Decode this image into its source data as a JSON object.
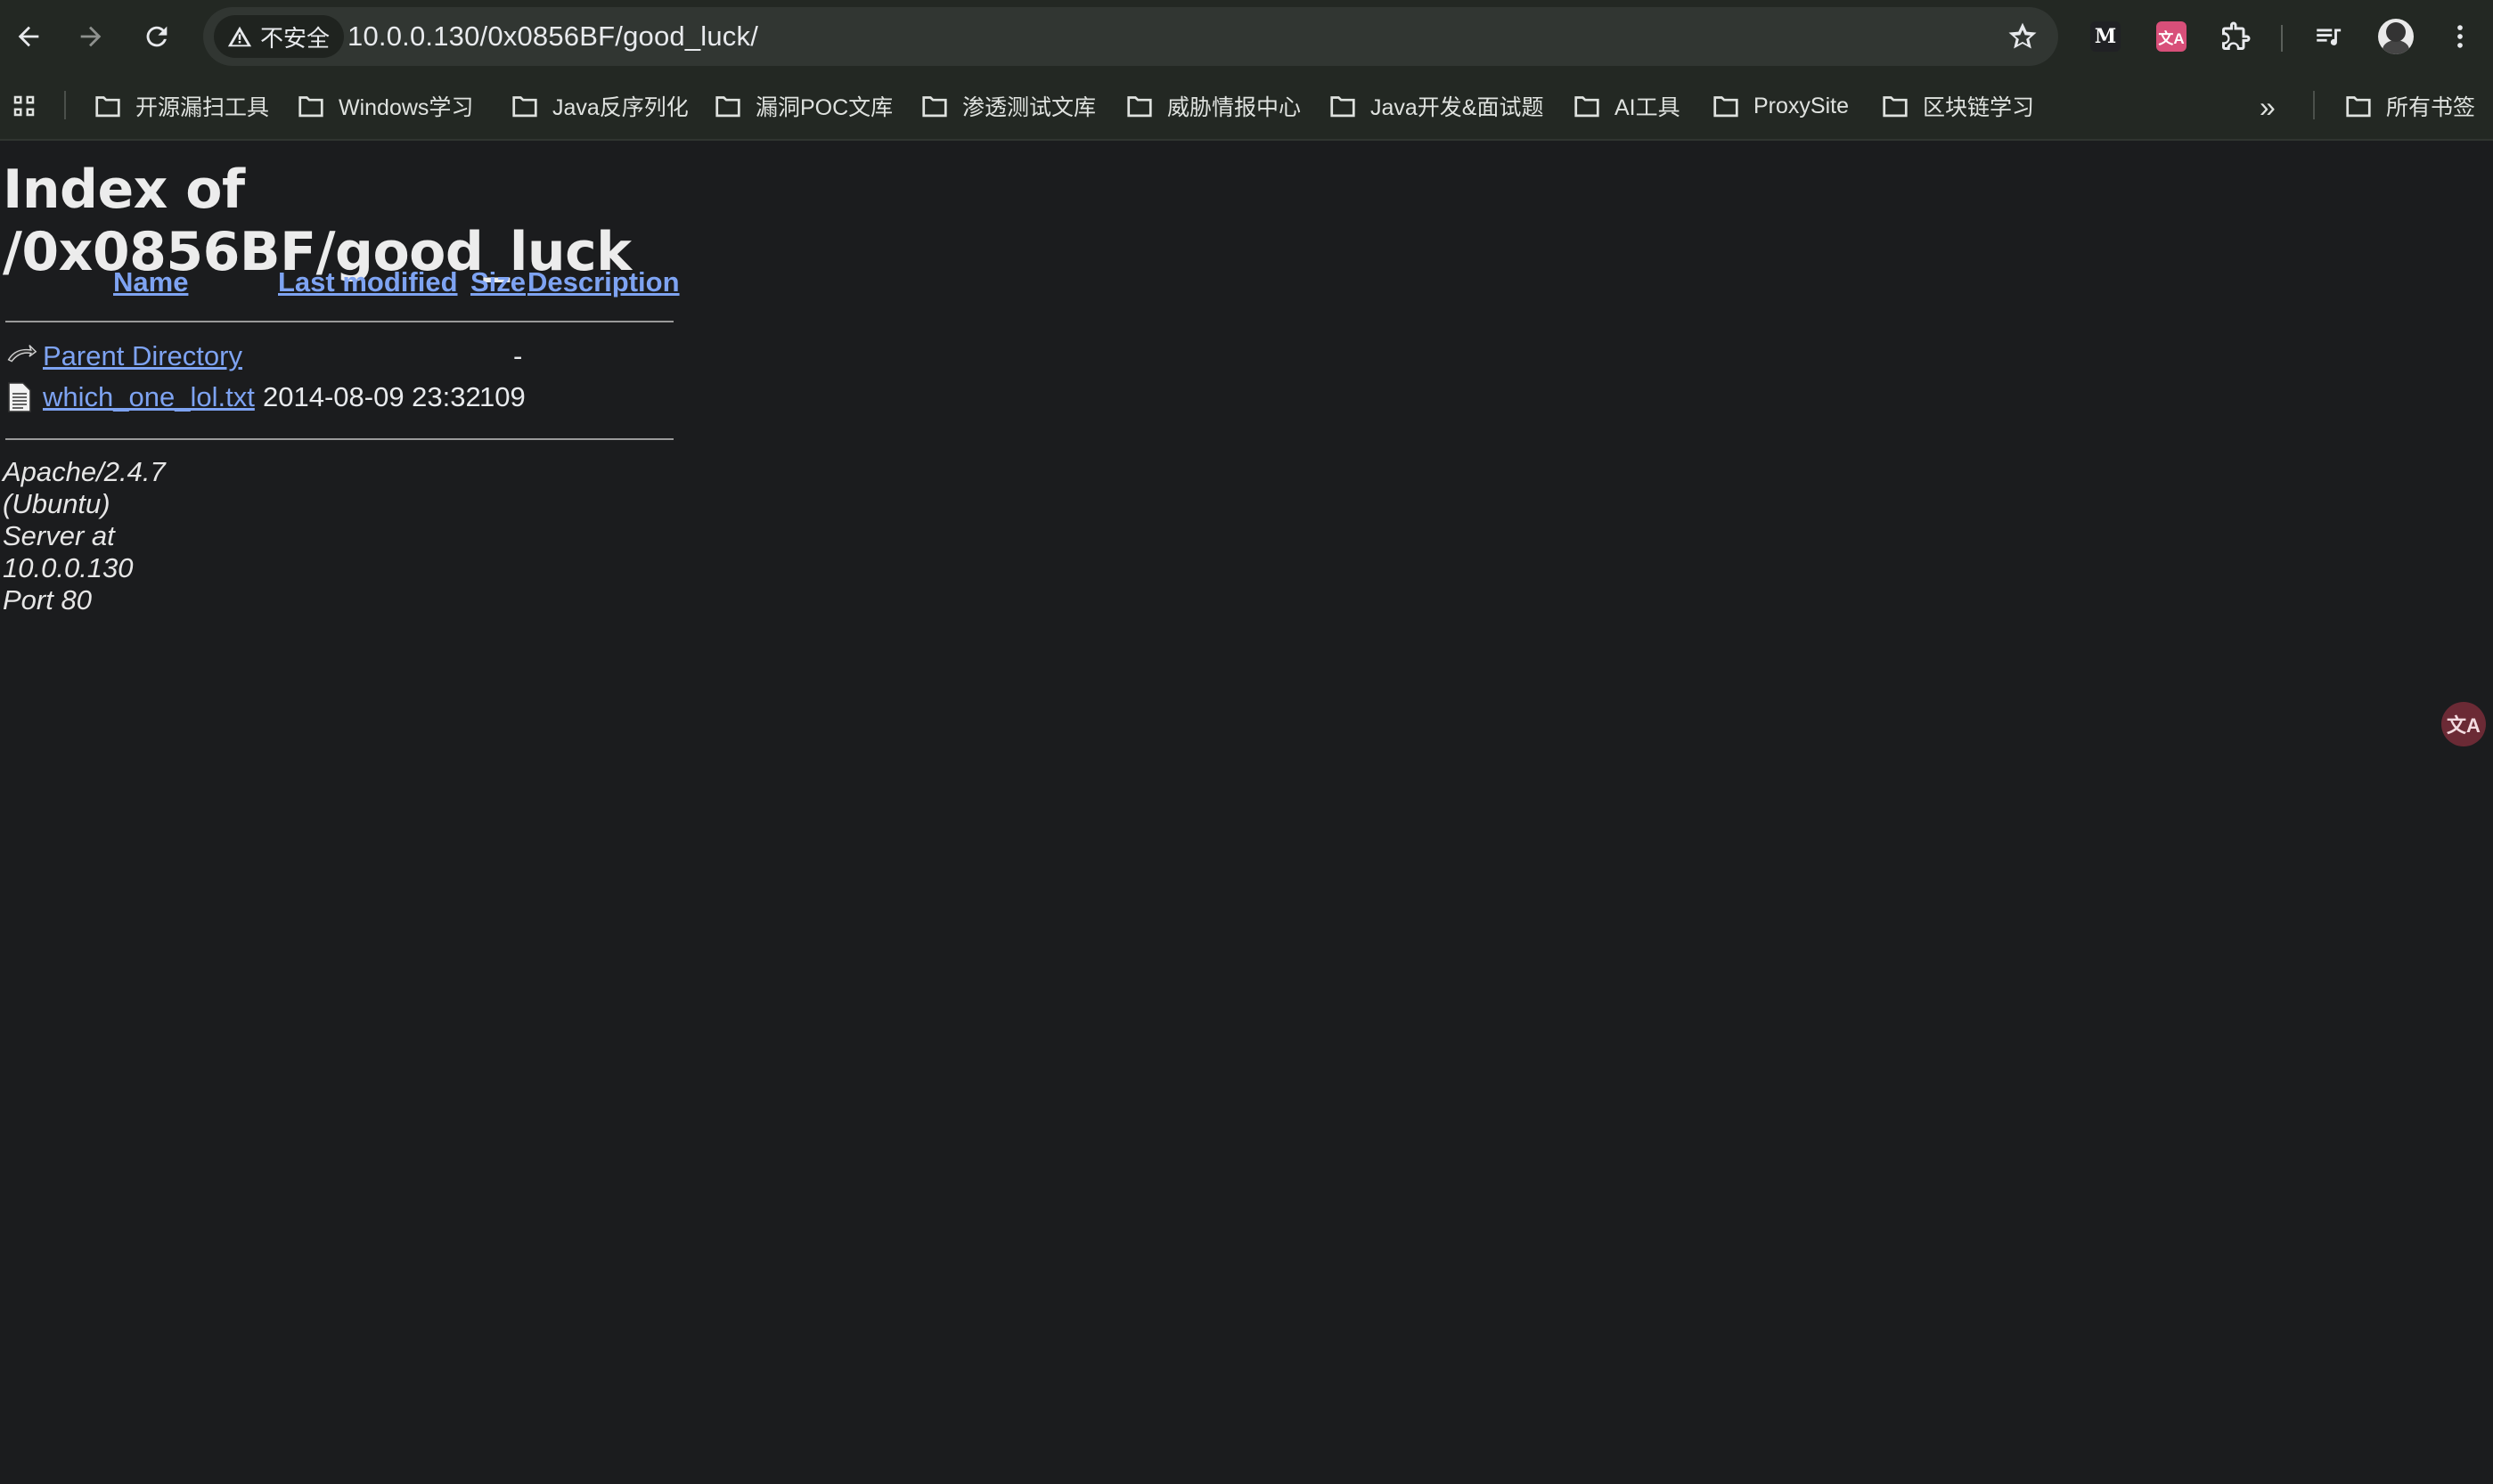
{
  "browser": {
    "security_label": "不安全",
    "url": "10.0.0.130/0x0856BF/good_luck/",
    "extensions": {
      "m_label": "M",
      "translate_label": "文A"
    }
  },
  "bookmarks": [
    "开源漏扫工具",
    "Windows学习",
    "Java反序列化",
    "漏洞POC文库",
    "渗透测试文库",
    "威胁情报中心",
    "Java开发&面试题",
    "AI工具",
    "ProxySite",
    "区块链学习"
  ],
  "all_bookmarks_label": "所有书签",
  "more_bookmarks_label": "»",
  "page": {
    "title": "Index of /0x0856BF/good_luck",
    "columns": {
      "name": "Name",
      "last_modified": "Last modified",
      "size": "Size",
      "description": "Description"
    },
    "rows": [
      {
        "icon": "back-icon",
        "name": "Parent Directory",
        "last_modified": "",
        "size": "-",
        "description": ""
      },
      {
        "icon": "text-file-icon",
        "name": "which_one_lol.txt",
        "last_modified": "2014-08-09 23:32",
        "size": "109",
        "description": ""
      }
    ],
    "footer": "Apache/2.4.7 (Ubuntu) Server at 10.0.0.130 Port 80"
  },
  "floating_translate_label": "文A",
  "colors": {
    "link": "#7ea3f2",
    "background": "#1b1c1e",
    "chrome": "#232823"
  }
}
